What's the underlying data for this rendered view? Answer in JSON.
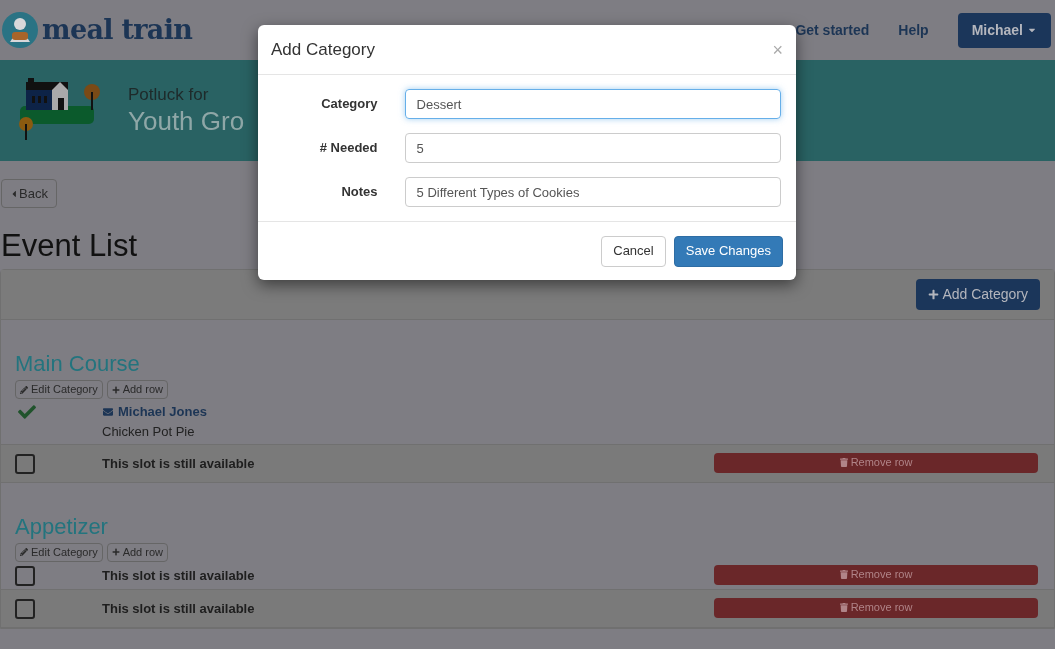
{
  "header": {
    "logo": "meal train",
    "nav": [
      "Get started",
      "Help"
    ],
    "user_menu": "Michael"
  },
  "banner": {
    "subtitle": "Potluck for",
    "title": "Youth Gro"
  },
  "back_button": "Back",
  "heading": "Event List",
  "add_category_button": "Add Category",
  "categories": [
    {
      "name": "Main Course",
      "edit_button": "Edit Category",
      "add_row_button": "Add row",
      "slots": [
        {
          "checked": true,
          "name": "Michael Jones",
          "item": "Chicken Pot Pie"
        },
        {
          "checked": false,
          "text": "This slot is still available",
          "remove_button": "Remove row"
        }
      ]
    },
    {
      "name": "Appetizer",
      "edit_button": "Edit Category",
      "add_row_button": "Add row",
      "slots": [
        {
          "checked": false,
          "text": "This slot is still available",
          "remove_button": "Remove row"
        },
        {
          "checked": false,
          "text": "This slot is still available",
          "remove_button": "Remove row"
        }
      ]
    }
  ],
  "dialog": {
    "title": "Add Category",
    "close": "×",
    "fields": [
      {
        "label": "Category",
        "value": "Dessert",
        "focused": true
      },
      {
        "label": "# Needed",
        "value": "5",
        "focused": false
      },
      {
        "label": "Notes",
        "value": "5 Different Types of Cookies",
        "focused": false
      }
    ],
    "cancel_button": "Cancel",
    "save_button": "Save Changes"
  }
}
